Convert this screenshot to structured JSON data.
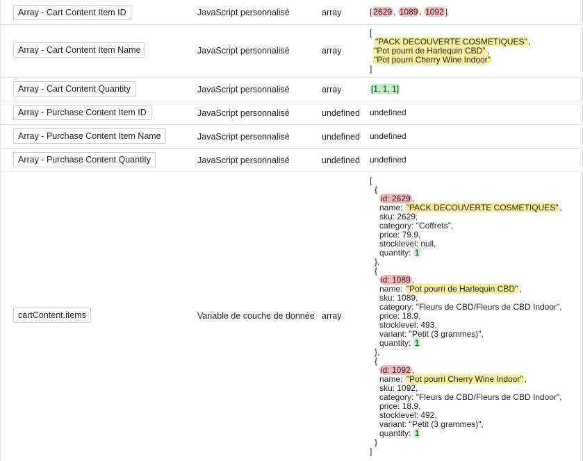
{
  "rows": [
    {
      "name": "Array - Cart Content Item ID",
      "type": "JavaScript personnalisé",
      "dtype": "array",
      "value": {
        "open": "[",
        "items": [
          "2629",
          "1089",
          "1092"
        ],
        "sep": ", ",
        "close": "]"
      }
    },
    {
      "name": "Array - Cart Content Item Name",
      "type": "JavaScript personnalisé",
      "dtype": "array",
      "value": {
        "open": "[",
        "lines": [
          "\"PACK DECOUVERTE COSMETIQUES\"",
          "\"Pot pourri de Harlequin CBD\"",
          "\"Pot pourri Cherry Wine Indoor\""
        ],
        "close": "]"
      }
    },
    {
      "name": "Array - Cart Content Quantity",
      "type": "JavaScript personnalisé",
      "dtype": "array",
      "value": "[1, 1, 1]"
    },
    {
      "name": "Array - Purchase Content Item ID",
      "type": "JavaScript personnalisé",
      "dtype": "undefined",
      "value": "undefined"
    },
    {
      "name": "Array - Purchase Content Item Name",
      "type": "JavaScript personnalisé",
      "dtype": "undefined",
      "value": "undefined"
    },
    {
      "name": "Array - Purchase Content Quantity",
      "type": "JavaScript personnalisé",
      "dtype": "undefined",
      "value": "undefined"
    },
    {
      "name": "cartContent.items",
      "type": "Variable de couche de donnée",
      "dtype": "array",
      "value": {
        "lines": [
          "[",
          "  {",
          "    id: 2629,",
          "    name: \"PACK DECOUVERTE COSMETIQUES\",",
          "    sku: 2629,",
          "    category: \"Coffrets\",",
          "    price: 79.9,",
          "    stocklevel: null,",
          "    quantity: 1",
          "  },",
          "  {",
          "    id: 1089,",
          "    name: \"Pot pourri de Harlequin CBD\",",
          "    sku: 1089,",
          "    category: \"Fleurs de CBD/Fleurs de CBD Indoor\",",
          "    price: 18.9,",
          "    stocklevel: 493,",
          "    variant: \"Petit (3 grammes)\",",
          "    quantity: 1",
          "  },",
          "  {",
          "    id: 1092,",
          "    name: \"Pot pourri Cherry Wine Indoor\",",
          "    sku: 1092,",
          "    category: \"Fleurs de CBD/Fleurs de CBD Indoor\",",
          "    price: 18.9,",
          "    stocklevel: 492,",
          "    variant: \"Petit (3 grammes)\",",
          "    quantity: 1",
          "  }",
          "]"
        ]
      }
    }
  ],
  "highlight_colors": {
    "id": "#f5b8be",
    "name": "#f8ef9e",
    "quantity": "#bff2c0"
  }
}
